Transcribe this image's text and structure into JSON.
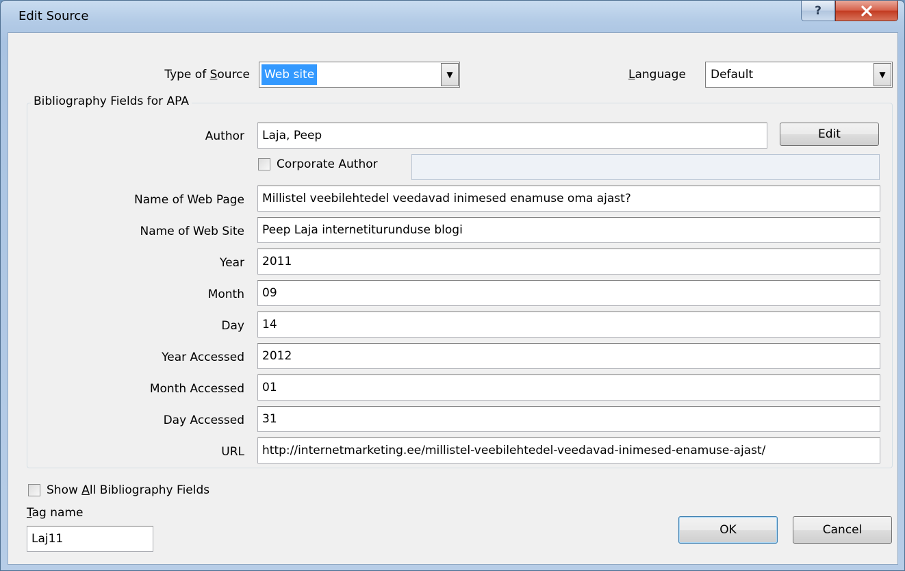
{
  "window": {
    "title": "Edit Source"
  },
  "titlebar": {
    "help_glyph": "?",
    "close_glyph": "✕"
  },
  "type_of_source": {
    "label_pre": "Type of ",
    "label_key": "S",
    "label_post": "ource",
    "value": "Web site"
  },
  "language": {
    "label_key": "L",
    "label_post": "anguage",
    "value": "Default"
  },
  "group_title": "Bibliography Fields for APA",
  "author": {
    "label": "Author",
    "value": "Laja, Peep",
    "edit_label": "Edit"
  },
  "corporate_author": {
    "label": "Corporate Author",
    "value": ""
  },
  "fields": [
    {
      "label": "Name of Web Page",
      "value": "Millistel veebilehtedel veedavad inimesed enamuse oma ajast?"
    },
    {
      "label": "Name of Web Site",
      "value": "Peep Laja internetiturunduse blogi"
    },
    {
      "label": "Year",
      "value": "2011"
    },
    {
      "label": "Month",
      "value": "09"
    },
    {
      "label": "Day",
      "value": "14"
    },
    {
      "label": "Year Accessed",
      "value": "2012"
    },
    {
      "label": "Month Accessed",
      "value": "01"
    },
    {
      "label": "Day Accessed",
      "value": "31"
    },
    {
      "label": "URL",
      "value": "http://internetmarketing.ee/millistel-veebilehtedel-veedavad-inimesed-enamuse-ajast/"
    }
  ],
  "show_all": {
    "label_pre": "Show ",
    "label_key": "A",
    "label_post": "ll Bibliography Fields"
  },
  "tag": {
    "label_key": "T",
    "label_post": "ag name",
    "value": "Laj11"
  },
  "buttons": {
    "ok": "OK",
    "cancel": "Cancel"
  },
  "colors": {
    "selection": "#3399ff",
    "close_button": "#c23a20",
    "dialog_bg": "#f0f0f0"
  }
}
